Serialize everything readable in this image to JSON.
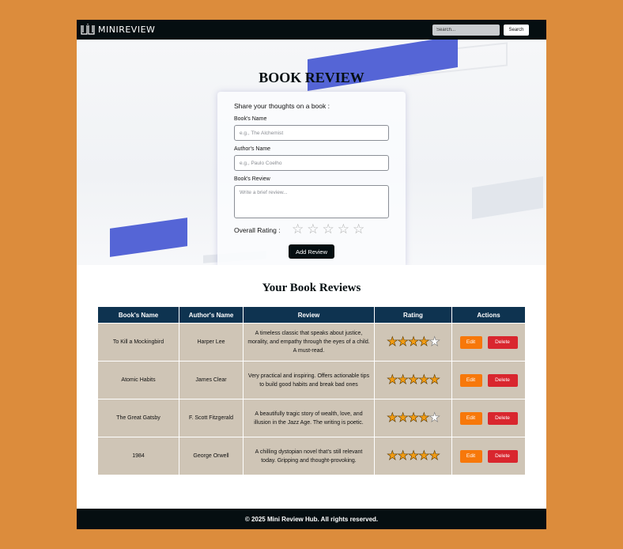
{
  "colors": {
    "background": "#DC8C3C",
    "navbar": "#050E11",
    "table_header": "#0E3350",
    "table_cell": "#CFC5B6",
    "edit_button": "#F7780A",
    "delete_button": "#D9262E",
    "star_filled": "#F39C12"
  },
  "navbar": {
    "logo_icon": "book-logo-icon",
    "logo_text": "MINIREVIEW",
    "search_placeholder": "Search...",
    "search_button": "Search"
  },
  "hero": {
    "title": "BOOK REVIEW"
  },
  "form": {
    "heading": "Share your thoughts on a book :",
    "book_label": "Book's Name",
    "book_placeholder": "e.g., The Alchemist",
    "author_label": "Author's Name",
    "author_placeholder": "e.g., Paulo Coelho",
    "review_label": "Book's Review",
    "review_placeholder": "Write a brief review...",
    "rating_label": "Overall Rating :",
    "rating_value": 0,
    "rating_max": 5,
    "submit_label": "Add Review"
  },
  "reviews": {
    "title": "Your Book Reviews",
    "columns": [
      "Book's Name",
      "Author's Name",
      "Review",
      "Rating",
      "Actions"
    ],
    "rows": [
      {
        "book": "To Kill a Mockingbird",
        "author": "Harper Lee",
        "review": "A timeless classic that speaks about justice, morality, and empathy through the eyes of a child. A must-read.",
        "rating": 4,
        "edit": "Edit",
        "delete": "Delete"
      },
      {
        "book": "Atomic Habits",
        "author": "James Clear",
        "review": "Very practical and inspiring. Offers actionable tips to build good habits and break bad ones",
        "rating": 5,
        "edit": "Edit",
        "delete": "Delete"
      },
      {
        "book": "The Great Gatsby",
        "author": "F. Scott Fitzgerald",
        "review": "A beautifully tragic story of wealth, love, and illusion in the Jazz Age. The writing is poetic.",
        "rating": 4,
        "edit": "Edit",
        "delete": "Delete"
      },
      {
        "book": "1984",
        "author": "George Orwell",
        "review": "A chilling dystopian novel that’s still relevant today. Gripping and thought-provoking.",
        "rating": 5,
        "edit": "Edit",
        "delete": "Delete"
      }
    ]
  },
  "footer": {
    "text": "© 2025 Mini Review Hub. All rights reserved."
  }
}
